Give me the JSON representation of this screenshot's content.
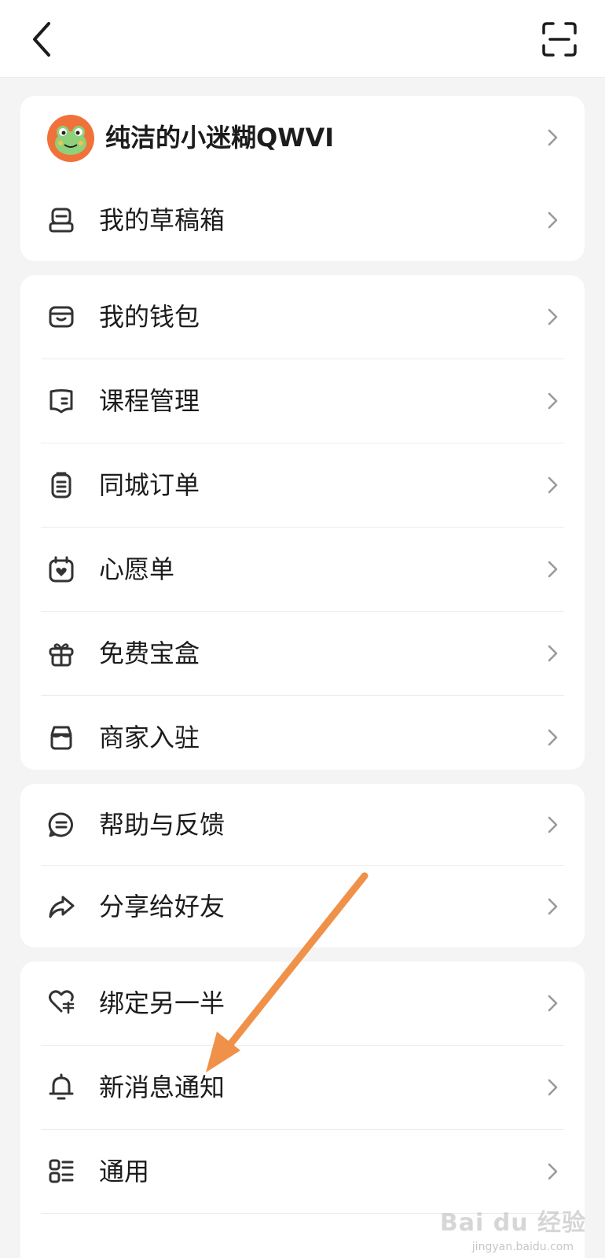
{
  "profile": {
    "name": "纯洁的小迷糊QWVI"
  },
  "cards": [
    {
      "items": [
        {
          "label": "我的草稿箱",
          "icon": "drafts-icon"
        }
      ]
    },
    {
      "items": [
        {
          "label": "我的钱包",
          "icon": "wallet-icon"
        },
        {
          "label": "课程管理",
          "icon": "course-book-icon"
        },
        {
          "label": "同城订单",
          "icon": "order-list-icon"
        },
        {
          "label": "心愿单",
          "icon": "wishlist-heart-calendar-icon"
        },
        {
          "label": "免费宝盒",
          "icon": "gift-box-icon"
        },
        {
          "label": "商家入驻",
          "icon": "store-icon"
        }
      ]
    },
    {
      "items": [
        {
          "label": "帮助与反馈",
          "icon": "help-chat-icon"
        },
        {
          "label": "分享给好友",
          "icon": "share-icon"
        }
      ]
    },
    {
      "items": [
        {
          "label": "绑定另一半",
          "icon": "heart-link-icon"
        },
        {
          "label": "新消息通知",
          "icon": "bell-icon"
        },
        {
          "label": "通用",
          "icon": "general-settings-icon"
        }
      ]
    }
  ],
  "watermark": {
    "text": "Bai du 经验",
    "sub": "jingyan.baidu.com"
  },
  "colors": {
    "annotation_arrow": "#f0914a",
    "avatar_bg": "#f0723a",
    "background": "#f4f4f4"
  }
}
